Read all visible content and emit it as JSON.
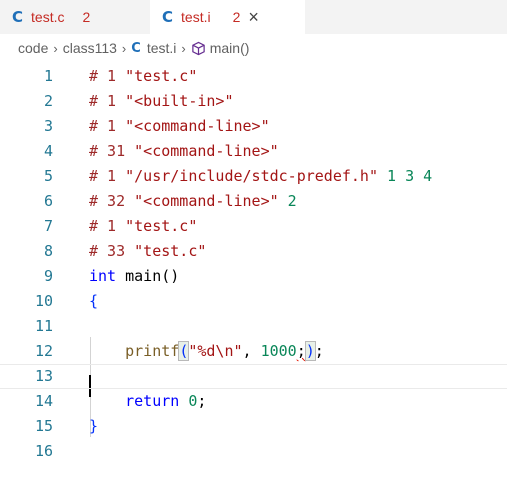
{
  "tabs": [
    {
      "icon": "C",
      "name": "test.c",
      "problems": "2",
      "active": false
    },
    {
      "icon": "C",
      "name": "test.i",
      "problems": "2",
      "active": true,
      "close": "×"
    }
  ],
  "breadcrumb": {
    "items": [
      "code",
      "class113",
      "test.i",
      "main()"
    ],
    "separator": "›",
    "file_icon": "C"
  },
  "editor": {
    "lines": [
      {
        "n": "1",
        "tokens": [
          {
            "t": "# 1 ",
            "c": "dir"
          },
          {
            "t": "\"test.c\"",
            "c": "str"
          }
        ]
      },
      {
        "n": "2",
        "tokens": [
          {
            "t": "# 1 ",
            "c": "dir"
          },
          {
            "t": "\"<built-in>\"",
            "c": "str"
          }
        ]
      },
      {
        "n": "3",
        "tokens": [
          {
            "t": "# 1 ",
            "c": "dir"
          },
          {
            "t": "\"<command-line>\"",
            "c": "str"
          }
        ]
      },
      {
        "n": "4",
        "tokens": [
          {
            "t": "# 31 ",
            "c": "dir"
          },
          {
            "t": "\"<command-line>\"",
            "c": "str"
          }
        ]
      },
      {
        "n": "5",
        "tokens": [
          {
            "t": "# 1 ",
            "c": "dir"
          },
          {
            "t": "\"/usr/include/stdc-predef.h\"",
            "c": "str"
          },
          {
            "t": " 1 3 4",
            "c": "num"
          }
        ]
      },
      {
        "n": "6",
        "tokens": [
          {
            "t": "# 32 ",
            "c": "dir"
          },
          {
            "t": "\"<command-line>\"",
            "c": "str"
          },
          {
            "t": " 2",
            "c": "num"
          }
        ]
      },
      {
        "n": "7",
        "tokens": [
          {
            "t": "# 1 ",
            "c": "dir"
          },
          {
            "t": "\"test.c\"",
            "c": "str"
          }
        ]
      },
      {
        "n": "8",
        "tokens": [
          {
            "t": "# 33 ",
            "c": "dir"
          },
          {
            "t": "\"test.c\"",
            "c": "str"
          }
        ]
      },
      {
        "n": "9",
        "tokens": [
          {
            "t": "int",
            "c": "kw"
          },
          {
            "t": " main",
            "c": "txt"
          },
          {
            "t": "()",
            "c": "txt"
          }
        ]
      },
      {
        "n": "10",
        "tokens": [
          {
            "t": "{",
            "c": "paren"
          }
        ]
      },
      {
        "n": "11",
        "tokens": []
      },
      {
        "n": "12",
        "tokens": [
          {
            "t": "    printf",
            "c": "fn"
          },
          {
            "t": "(",
            "c": "pair"
          },
          {
            "t": "\"%d\\n\"",
            "c": "str"
          },
          {
            "t": ", ",
            "c": "txt"
          },
          {
            "t": "1000",
            "c": "num"
          },
          {
            "t": ";",
            "c": "squig"
          },
          {
            "t": ")",
            "c": "pair"
          },
          {
            "t": ";",
            "c": "txt"
          }
        ]
      },
      {
        "n": "13",
        "tokens": [],
        "current": true
      },
      {
        "n": "14",
        "tokens": [
          {
            "t": "    return",
            "c": "kw"
          },
          {
            "t": " ",
            "c": "txt"
          },
          {
            "t": "0",
            "c": "num"
          },
          {
            "t": ";",
            "c": "txt"
          }
        ]
      },
      {
        "n": "15",
        "tokens": [
          {
            "t": "}",
            "c": "paren"
          }
        ]
      },
      {
        "n": "16",
        "tokens": []
      }
    ]
  },
  "colors": {
    "accent_c_icon": "#1f6fb8",
    "error_text": "#c52b24",
    "line_number": "#237893",
    "keyword": "#0000ff",
    "string": "#a31515",
    "number": "#098658"
  }
}
